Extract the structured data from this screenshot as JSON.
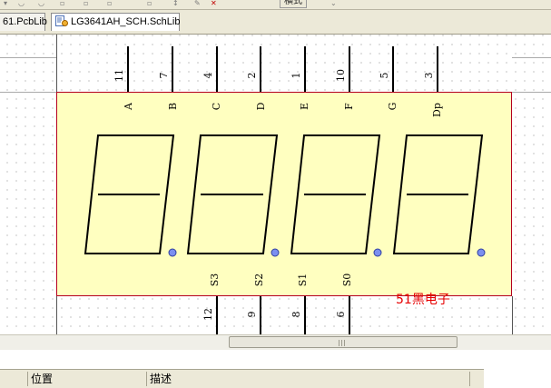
{
  "toolbar": {
    "partial_label": "横式"
  },
  "tabs": [
    {
      "label": "61.PcbLib",
      "icon": "pcb-lib-icon",
      "active": false
    },
    {
      "label": "LG3641AH_SCH.SchLib",
      "icon": "sch-lib-icon",
      "active": true
    }
  ],
  "component": {
    "top_pins": [
      {
        "number": "11",
        "name": "A"
      },
      {
        "number": "7",
        "name": "B"
      },
      {
        "number": "4",
        "name": "C"
      },
      {
        "number": "2",
        "name": "D"
      },
      {
        "number": "1",
        "name": "E"
      },
      {
        "number": "10",
        "name": "F"
      },
      {
        "number": "5",
        "name": "G"
      },
      {
        "number": "3",
        "name": "Dp"
      }
    ],
    "bottom_pins": [
      {
        "number": "12",
        "name": "S3"
      },
      {
        "number": "9",
        "name": "S2"
      },
      {
        "number": "8",
        "name": "S1"
      },
      {
        "number": "6",
        "name": "S0"
      }
    ],
    "digit_count": 4,
    "colors": {
      "body": "#ffffc0",
      "border": "#b4001e",
      "dp_dot": "#7b8ff0"
    }
  },
  "watermark": "51黑电子",
  "panel": {
    "columns": [
      "",
      "位置",
      "描述"
    ]
  }
}
